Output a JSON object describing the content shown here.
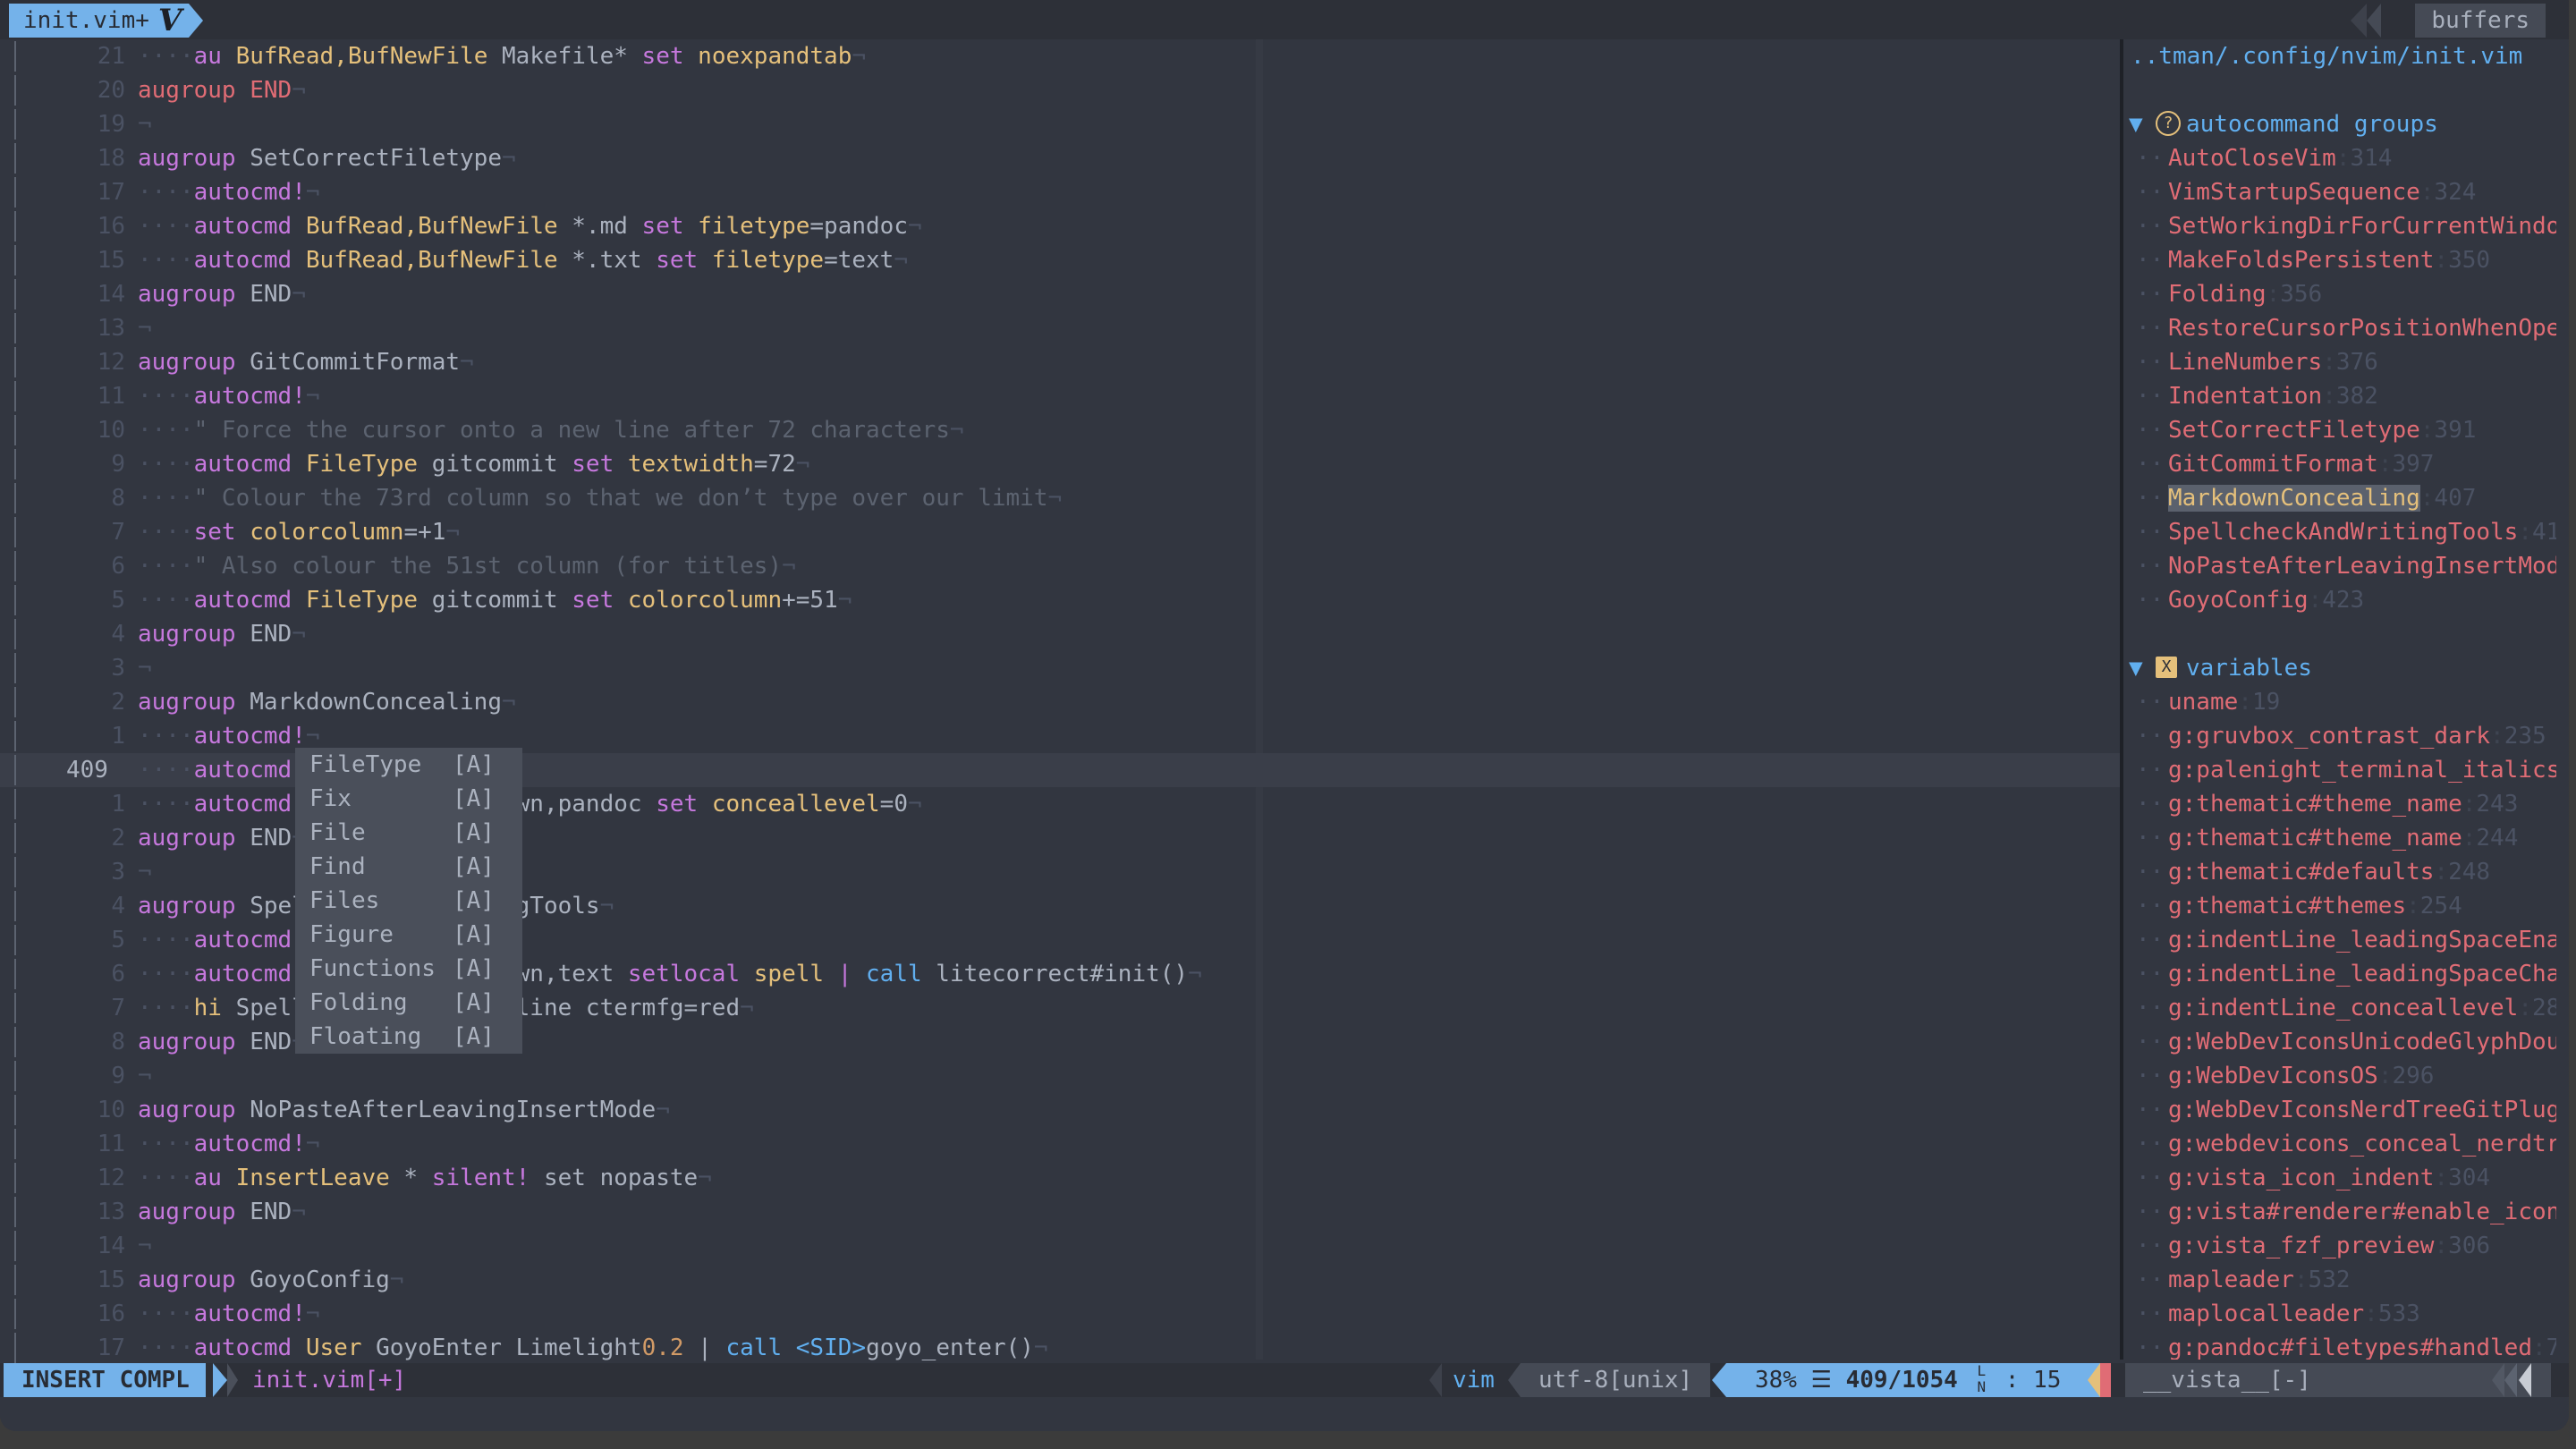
{
  "window": {
    "tab_active_label": "init.vim+",
    "tab_logo": "V",
    "buffers_label": "buffers"
  },
  "editor": {
    "current_line_number": "409",
    "lines": [
      {
        "n": "21",
        "indent": true,
        "tokens": [
          [
            "k",
            "au"
          ],
          [
            "t",
            " "
          ],
          [
            "y",
            "BufRead,BufNewFile"
          ],
          [
            "t",
            " Makefile* "
          ],
          [
            "k",
            "set"
          ],
          [
            "t",
            " "
          ],
          [
            "y",
            "noexpandtab"
          ]
        ]
      },
      {
        "n": "20",
        "indent": false,
        "tokens": [
          [
            "r",
            "augroup"
          ],
          [
            "t",
            " "
          ],
          [
            "r",
            "END"
          ]
        ]
      },
      {
        "n": "19",
        "indent": false,
        "tokens": []
      },
      {
        "n": "18",
        "indent": false,
        "tokens": [
          [
            "k",
            "augroup"
          ],
          [
            "t",
            " SetCorrectFiletype"
          ]
        ]
      },
      {
        "n": "17",
        "indent": true,
        "tokens": [
          [
            "k",
            "autocmd!"
          ]
        ]
      },
      {
        "n": "16",
        "indent": true,
        "tokens": [
          [
            "k",
            "autocmd"
          ],
          [
            "t",
            " "
          ],
          [
            "y",
            "BufRead,BufNewFile"
          ],
          [
            "t",
            " *.md "
          ],
          [
            "k",
            "set"
          ],
          [
            "t",
            " "
          ],
          [
            "y",
            "filetype"
          ],
          [
            "t",
            "=pandoc"
          ]
        ]
      },
      {
        "n": "15",
        "indent": true,
        "tokens": [
          [
            "k",
            "autocmd"
          ],
          [
            "t",
            " "
          ],
          [
            "y",
            "BufRead,BufNewFile"
          ],
          [
            "t",
            " *.txt "
          ],
          [
            "k",
            "set"
          ],
          [
            "t",
            " "
          ],
          [
            "y",
            "filetype"
          ],
          [
            "t",
            "=text"
          ]
        ]
      },
      {
        "n": "14",
        "indent": false,
        "tokens": [
          [
            "k",
            "augroup"
          ],
          [
            "t",
            " END"
          ]
        ]
      },
      {
        "n": "13",
        "indent": false,
        "tokens": []
      },
      {
        "n": "12",
        "indent": false,
        "tokens": [
          [
            "k",
            "augroup"
          ],
          [
            "t",
            " GitCommitFormat"
          ]
        ]
      },
      {
        "n": "11",
        "indent": true,
        "tokens": [
          [
            "k",
            "autocmd!"
          ]
        ]
      },
      {
        "n": "10",
        "indent": true,
        "tokens": [
          [
            "c",
            "\" Force the cursor onto a new line after 72 characters"
          ]
        ]
      },
      {
        "n": "9",
        "indent": true,
        "tokens": [
          [
            "k",
            "autocmd"
          ],
          [
            "t",
            " "
          ],
          [
            "y",
            "FileType"
          ],
          [
            "t",
            " gitcommit "
          ],
          [
            "k",
            "set"
          ],
          [
            "t",
            " "
          ],
          [
            "y",
            "textwidth"
          ],
          [
            "t",
            "=72"
          ]
        ]
      },
      {
        "n": "8",
        "indent": true,
        "tokens": [
          [
            "c",
            "\" Colour the 73rd column so that we don’t type over our limit"
          ]
        ]
      },
      {
        "n": "7",
        "indent": true,
        "tokens": [
          [
            "k",
            "set"
          ],
          [
            "t",
            " "
          ],
          [
            "y",
            "colorcolumn"
          ],
          [
            "t",
            "=+1"
          ]
        ]
      },
      {
        "n": "6",
        "indent": true,
        "tokens": [
          [
            "c",
            "\" Also colour the 51st column (for titles)"
          ]
        ]
      },
      {
        "n": "5",
        "indent": true,
        "tokens": [
          [
            "k",
            "autocmd"
          ],
          [
            "t",
            " "
          ],
          [
            "y",
            "FileType"
          ],
          [
            "t",
            " gitcommit "
          ],
          [
            "k",
            "set"
          ],
          [
            "t",
            " "
          ],
          [
            "y",
            "colorcolumn"
          ],
          [
            "t",
            "+=51"
          ]
        ]
      },
      {
        "n": "4",
        "indent": false,
        "tokens": [
          [
            "k",
            "augroup"
          ],
          [
            "t",
            " END"
          ]
        ]
      },
      {
        "n": "3",
        "indent": false,
        "tokens": []
      },
      {
        "n": "2",
        "indent": false,
        "tokens": [
          [
            "k",
            "augroup"
          ],
          [
            "t",
            " MarkdownConcealing"
          ]
        ]
      },
      {
        "n": "1",
        "indent": true,
        "tokens": [
          [
            "k",
            "autocmd!"
          ]
        ]
      },
      {
        "n": "409",
        "indent": true,
        "current": true,
        "tokens": [
          [
            "k",
            "autocmd"
          ],
          [
            "t",
            " Fi"
          ]
        ]
      },
      {
        "n": "1",
        "indent": true,
        "tokens": [
          [
            "k",
            "autocmd"
          ],
          [
            "t",
            " FileType markdown,pandoc "
          ],
          [
            "k",
            "set"
          ],
          [
            "t",
            " "
          ],
          [
            "y",
            "conceallevel"
          ],
          [
            "t",
            "=0"
          ]
        ]
      },
      {
        "n": "2",
        "indent": false,
        "tokens": [
          [
            "k",
            "augroup"
          ],
          [
            "t",
            " END"
          ]
        ]
      },
      {
        "n": "3",
        "indent": false,
        "tokens": []
      },
      {
        "n": "4",
        "indent": false,
        "tokens": [
          [
            "k",
            "augroup"
          ],
          [
            "t",
            " SpellcheckAndWritingTools"
          ]
        ]
      },
      {
        "n": "5",
        "indent": true,
        "tokens": [
          [
            "k",
            "autocmd"
          ],
          [
            "t",
            " "
          ]
        ]
      },
      {
        "n": "6",
        "indent": true,
        "tokens": [
          [
            "k",
            "autocmd"
          ],
          [
            "t",
            " FileType markdown,text "
          ],
          [
            "k",
            "setlocal"
          ],
          [
            "t",
            " "
          ],
          [
            "y",
            "spell"
          ],
          [
            "t",
            " "
          ],
          [
            "k",
            "|"
          ],
          [
            "t",
            " "
          ],
          [
            "b",
            "call"
          ],
          [
            "t",
            " litecorrect#init()"
          ]
        ]
      },
      {
        "n": "7",
        "indent": true,
        "tokens": [
          [
            "y",
            "hi"
          ],
          [
            "t",
            " SpellBad cterm=underline ctermfg=red"
          ]
        ]
      },
      {
        "n": "8",
        "indent": false,
        "tokens": [
          [
            "k",
            "augroup"
          ],
          [
            "t",
            " END"
          ]
        ]
      },
      {
        "n": "9",
        "indent": false,
        "tokens": []
      },
      {
        "n": "10",
        "indent": false,
        "tokens": [
          [
            "k",
            "augroup"
          ],
          [
            "t",
            " NoPasteAfterLeavingInsertMode"
          ]
        ]
      },
      {
        "n": "11",
        "indent": true,
        "tokens": [
          [
            "k",
            "autocmd!"
          ]
        ]
      },
      {
        "n": "12",
        "indent": true,
        "tokens": [
          [
            "k",
            "au"
          ],
          [
            "t",
            " "
          ],
          [
            "y",
            "InsertLeave"
          ],
          [
            "t",
            " * "
          ],
          [
            "k",
            "silent!"
          ],
          [
            "t",
            " set nopaste"
          ]
        ]
      },
      {
        "n": "13",
        "indent": false,
        "tokens": [
          [
            "k",
            "augroup"
          ],
          [
            "t",
            " END"
          ]
        ]
      },
      {
        "n": "14",
        "indent": false,
        "tokens": []
      },
      {
        "n": "15",
        "indent": false,
        "tokens": [
          [
            "k",
            "augroup"
          ],
          [
            "t",
            " GoyoConfig"
          ]
        ]
      },
      {
        "n": "16",
        "indent": true,
        "tokens": [
          [
            "k",
            "autocmd!"
          ]
        ]
      },
      {
        "n": "17",
        "indent": true,
        "tokens": [
          [
            "k",
            "autocmd"
          ],
          [
            "t",
            " "
          ],
          [
            "y",
            "User"
          ],
          [
            "t",
            " GoyoEnter Limelight"
          ],
          [
            "o",
            "0.2"
          ],
          [
            "t",
            " | "
          ],
          [
            "b",
            "call"
          ],
          [
            "t",
            " "
          ],
          [
            "b",
            "<SID>"
          ],
          [
            "t",
            "goyo_enter()"
          ]
        ]
      }
    ]
  },
  "completion_menu": {
    "items": [
      {
        "word": "FileType",
        "kind": "[A]"
      },
      {
        "word": "Fix",
        "kind": "[A]"
      },
      {
        "word": "File",
        "kind": "[A]"
      },
      {
        "word": "Find",
        "kind": "[A]"
      },
      {
        "word": "Files",
        "kind": "[A]"
      },
      {
        "word": "Figure",
        "kind": "[A]"
      },
      {
        "word": "Functions",
        "kind": "[A]"
      },
      {
        "word": "Folding",
        "kind": "[A]"
      },
      {
        "word": "Floating",
        "kind": "[A]"
      }
    ]
  },
  "vista": {
    "path": "..tman/.config/nvim/init.vim",
    "groups": [
      {
        "title": "autocommand groups",
        "icon": "question-circle-icon",
        "items": [
          {
            "name": "AutoCloseVim",
            "line": "314"
          },
          {
            "name": "VimStartupSequence",
            "line": "324"
          },
          {
            "name": "SetWorkingDirForCurrentWindo",
            "line": ""
          },
          {
            "name": "MakeFoldsPersistent",
            "line": "350"
          },
          {
            "name": "Folding",
            "line": "356"
          },
          {
            "name": "RestoreCursorPositionWhenOpe",
            "line": ""
          },
          {
            "name": "LineNumbers",
            "line": "376"
          },
          {
            "name": "Indentation",
            "line": "382"
          },
          {
            "name": "SetCorrectFiletype",
            "line": "391"
          },
          {
            "name": "GitCommitFormat",
            "line": "397"
          },
          {
            "name": "MarkdownConcealing",
            "line": "407",
            "highlighted": true
          },
          {
            "name": "SpellcheckAndWritingTools",
            "line": "41"
          },
          {
            "name": "NoPasteAfterLeavingInsertMod",
            "line": ""
          },
          {
            "name": "GoyoConfig",
            "line": "423"
          }
        ]
      },
      {
        "title": "variables",
        "icon": "x-box-icon",
        "items": [
          {
            "name": "uname",
            "line": "19"
          },
          {
            "name": "g:gruvbox_contrast_dark",
            "line": "235"
          },
          {
            "name": "g:palenight_terminal_italics",
            "line": ""
          },
          {
            "name": "g:thematic#theme_name",
            "line": "243"
          },
          {
            "name": "g:thematic#theme_name",
            "line": "244"
          },
          {
            "name": "g:thematic#defaults",
            "line": "248"
          },
          {
            "name": "g:thematic#themes",
            "line": "254"
          },
          {
            "name": "g:indentLine_leadingSpaceEna",
            "line": ""
          },
          {
            "name": "g:indentLine_leadingSpaceCha",
            "line": ""
          },
          {
            "name": "g:indentLine_conceallevel",
            "line": "28"
          },
          {
            "name": "g:WebDevIconsUnicodeGlyphDou",
            "line": ""
          },
          {
            "name": "g:WebDevIconsOS",
            "line": "296"
          },
          {
            "name": "g:WebDevIconsNerdTreeGitPlug",
            "line": ""
          },
          {
            "name": "g:webdevicons_conceal_nerdtr",
            "line": ""
          },
          {
            "name": "g:vista_icon_indent",
            "line": "304"
          },
          {
            "name": "g:vista#renderer#enable_icon",
            "line": ""
          },
          {
            "name": "g:vista_fzf_preview",
            "line": "306"
          },
          {
            "name": "mapleader",
            "line": "532"
          },
          {
            "name": "maplocalleader",
            "line": "533"
          },
          {
            "name": "g:pandoc#filetypes#handled",
            "line": "7"
          }
        ]
      }
    ]
  },
  "statusline": {
    "mode": "INSERT COMPL",
    "filename": "init.vim[+]",
    "filetype": "vim",
    "encoding": "utf-8[unix]",
    "percent": "38%",
    "position": "409/1054",
    "line_icon": "␤",
    "column": "15",
    "vista_name": "__vista__[-]"
  },
  "colors": {
    "accent": "#74b2ea",
    "keyword": "#c678dd",
    "string": "#e5c07b",
    "error": "#e06c75",
    "background": "#323640"
  }
}
